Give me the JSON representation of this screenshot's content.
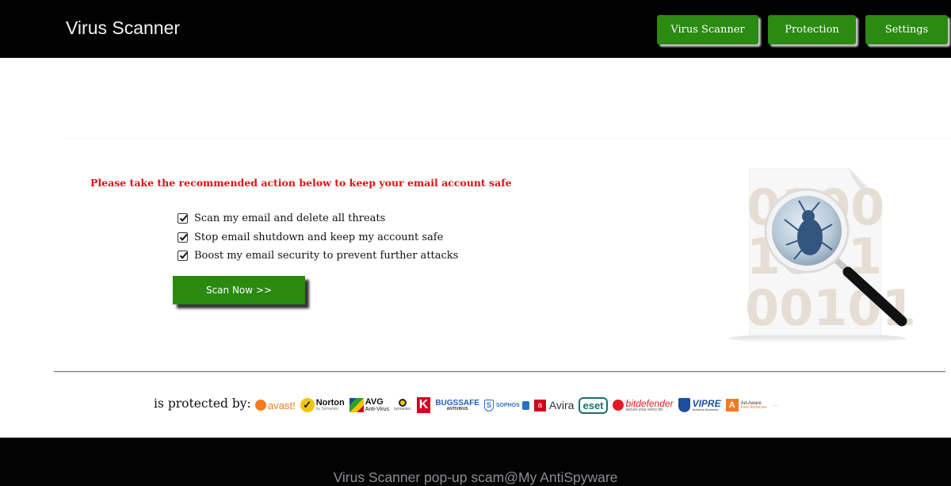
{
  "header": {
    "brand": "Virus Scanner",
    "nav": [
      {
        "label": "Virus Scanner"
      },
      {
        "label": "Protection"
      },
      {
        "label": "Settings"
      }
    ]
  },
  "main": {
    "warning": "Please take the recommended action below to keep your email account safe",
    "checklist": [
      {
        "label": "Scan my email and delete all threats",
        "checked": true
      },
      {
        "label": "Stop email shutdown and keep my account safe",
        "checked": true
      },
      {
        "label": "Boost my email security to prevent further attacks",
        "checked": true
      }
    ],
    "scan_button": "Scan Now >>",
    "illustration": {
      "icon": "bug-magnifier-icon",
      "digits": [
        "01",
        "100",
        "1",
        "00101"
      ]
    }
  },
  "protection": {
    "label": "is protected by:",
    "logos": [
      {
        "name": "avast",
        "text": "avast!",
        "color": "#f47b20"
      },
      {
        "name": "norton",
        "text": "Norton",
        "sub": "by Symantec",
        "color": "#f5c400"
      },
      {
        "name": "avg",
        "text": "AVG",
        "sub": "Anti-Virus",
        "color": "#1a4d9c"
      },
      {
        "name": "symantec",
        "text": "symantec.",
        "color": "#f5c400"
      },
      {
        "name": "kaspersky",
        "text": "K",
        "color": "#d2001f"
      },
      {
        "name": "bugssafe",
        "text": "BUGSSAFE",
        "sub": "ANTIVIRUS",
        "color": "#1c5fb8"
      },
      {
        "name": "sophos",
        "text": "SOPHOS",
        "color": "#2a6fc9"
      },
      {
        "name": "avira",
        "text": "Avira",
        "color": "#d0021b"
      },
      {
        "name": "eset",
        "text": "eset",
        "color": "#1c6f6d"
      },
      {
        "name": "bitdefender",
        "text": "bitdefender",
        "sub": "secure your every bit",
        "color": "#e11b22"
      },
      {
        "name": "vipre",
        "text": "VIPRE",
        "sub": "Antivirus Business",
        "color": "#1d4e9e"
      },
      {
        "name": "ad-aware",
        "text": "Ad-Aware",
        "sub": "Free Antivirus+",
        "color": "#f47920"
      },
      {
        "name": "other",
        "text": "···",
        "color": "#999999"
      }
    ]
  },
  "footer": {
    "text": "Virus Scanner pop-up scam@My AntiSpyware"
  }
}
